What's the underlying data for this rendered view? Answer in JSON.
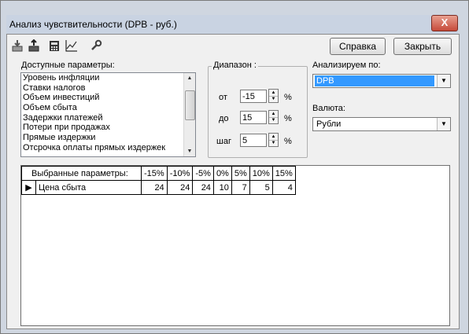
{
  "window": {
    "title": "Анализ чувствительности (DPB - руб.)",
    "close_glyph": "X"
  },
  "toolbar": {
    "icons": [
      "import-down-icon",
      "export-up-icon",
      "calculator-icon",
      "line-chart-icon",
      "wrench-icon"
    ],
    "help_label": "Справка",
    "close_label": "Закрыть"
  },
  "params": {
    "label": "Доступные параметры:",
    "items": [
      "Уровень инфляции",
      "Ставки налогов",
      "Объем инвестиций",
      "Объем сбыта",
      "Задержки платежей",
      "Потери при продажах",
      "Прямые издержки",
      "Отсрочка оплаты прямых издержек"
    ]
  },
  "range": {
    "title": "Диапазон :",
    "from_label": "от",
    "from_value": "-15",
    "to_label": "до",
    "to_value": "15",
    "step_label": "шаг",
    "step_value": "5",
    "unit": "%"
  },
  "analyze": {
    "label": "Анализируем по:",
    "value": "DPB"
  },
  "currency": {
    "label": "Валюта:",
    "value": "Рубли"
  },
  "grid": {
    "header_label": "Выбранные параметры:",
    "columns": [
      "-15%",
      "-10%",
      "-5%",
      "0%",
      "5%",
      "10%",
      "15%"
    ],
    "rows": [
      {
        "name": "Цена сбыта",
        "values": [
          "24",
          "24",
          "24",
          "10",
          "7",
          "5",
          "4"
        ]
      }
    ]
  }
}
